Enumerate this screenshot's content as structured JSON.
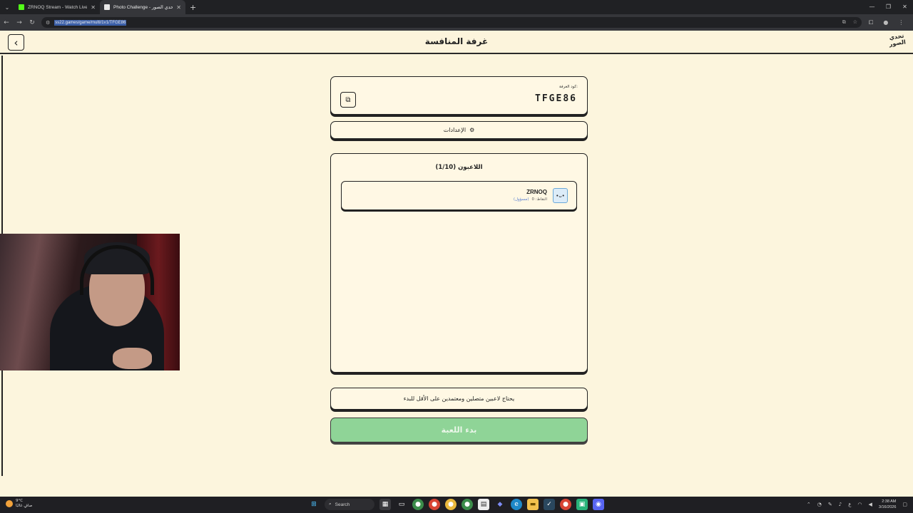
{
  "browser": {
    "tabs": [
      {
        "title": "ZRNOQ Stream - Watch Live o",
        "favicon_color": "#53fc18",
        "active": false
      },
      {
        "title": "Photo Challenge - تحدي الصور",
        "favicon_color": "#e8e8e8",
        "active": true
      }
    ],
    "url": "ss22.games/game/multi/1v1/TFGE86"
  },
  "header": {
    "title": "غرفة المنافسة",
    "logo_text": "تحدي الصور"
  },
  "room": {
    "code_label": "كود الغرفة:",
    "code": "TFGE86"
  },
  "settings": {
    "label": "الإعدادات"
  },
  "players": {
    "title": "اللاعبون (1/10)",
    "list": [
      {
        "name": "ZRNOQ",
        "score_label": "النقاط: 0",
        "status": "(مسؤول)"
      }
    ]
  },
  "notice": "يحتاج لاعبين متصلين ومعتمدين على الأقل للبدء",
  "start_button": "بدء اللعبة",
  "taskbar": {
    "weather_temp": "9°C",
    "weather_desc": "صافٍ غالبًا",
    "search_label": "Search",
    "time": "2:38 AM",
    "date": "3/16/2026"
  }
}
